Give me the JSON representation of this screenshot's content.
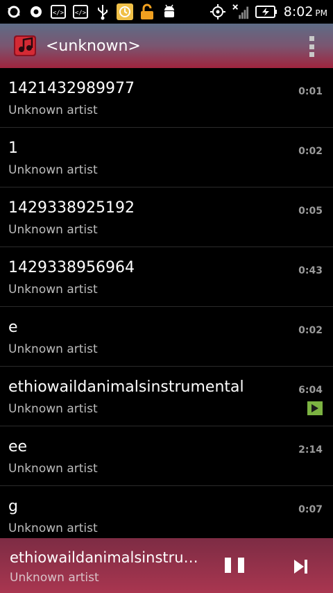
{
  "statusbar": {
    "time": "8:02",
    "ampm": "PM",
    "icons": [
      "sync-icon",
      "record-icon",
      "code-icon",
      "code-icon",
      "usb-icon",
      "clock-app-icon",
      "unlock-icon",
      "android-icon",
      "gps-icon",
      "no-signal-icon",
      "battery-charging-icon"
    ]
  },
  "actionbar": {
    "title": "<unknown>"
  },
  "tracks": [
    {
      "title": "1421432989977",
      "artist": "Unknown artist",
      "duration": "0:01"
    },
    {
      "title": "1",
      "artist": "Unknown artist",
      "duration": "0:02"
    },
    {
      "title": "1429338925192",
      "artist": "Unknown artist",
      "duration": "0:05"
    },
    {
      "title": "1429338956964",
      "artist": "Unknown artist",
      "duration": "0:43"
    },
    {
      "title": "e",
      "artist": "Unknown artist",
      "duration": "0:02"
    },
    {
      "title": "ethiowaildanimalsinstrumental",
      "artist": "Unknown artist",
      "duration": "6:04"
    },
    {
      "title": "ee",
      "artist": "Unknown artist",
      "duration": "2:14"
    },
    {
      "title": "g",
      "artist": "Unknown artist",
      "duration": "0:07"
    }
  ],
  "nowplaying": {
    "title": "ethiowaildanimalsinstru…",
    "artist": "Unknown artist"
  },
  "colors": {
    "accent_playing": "#7cb342",
    "actionbar_top": "#5e6c86",
    "actionbar_bottom": "#a0243e",
    "nowplaying_bg": "#a93650"
  }
}
